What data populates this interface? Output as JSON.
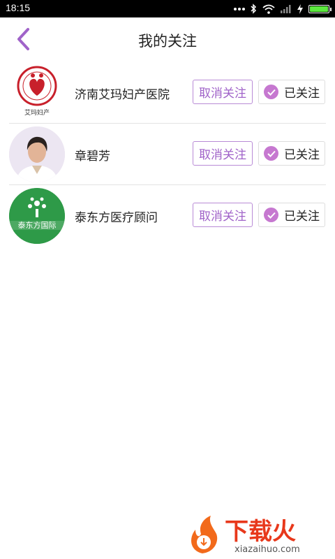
{
  "status_bar": {
    "time": "18:15",
    "icons": [
      "dots-icon",
      "bluetooth-icon",
      "wifi-icon",
      "signal-icon",
      "charging-icon",
      "battery-icon"
    ],
    "battery_color": "#5ce83f"
  },
  "header": {
    "title": "我的关注",
    "back_icon": "chevron-left-icon",
    "accent": "#a063c9"
  },
  "follows": [
    {
      "name": "济南艾玛妇产医院",
      "avatar": "hospital-logo",
      "logo_caption": "艾玛妇产",
      "cancel_label": "取消关注",
      "status_label": "已关注"
    },
    {
      "name": "章碧芳",
      "avatar": "doctor-photo",
      "cancel_label": "取消关注",
      "status_label": "已关注"
    },
    {
      "name": "泰东方医疗顾问",
      "avatar": "clinic-logo",
      "logo_caption": "泰东方国际",
      "cancel_label": "取消关注",
      "status_label": "已关注"
    }
  ],
  "watermark": {
    "brand": "下载火",
    "url": "xiazaihuo.com"
  }
}
